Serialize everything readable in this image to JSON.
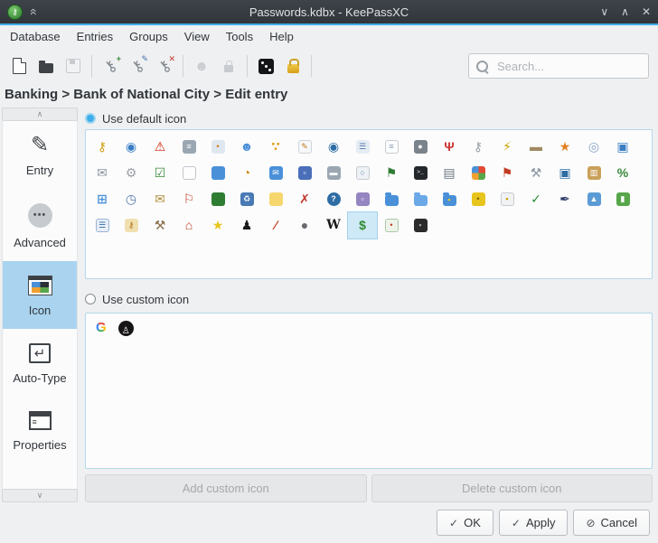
{
  "window": {
    "title": "Passwords.kdbx - KeePassXC"
  },
  "titlebar": {
    "shade_glyph": "«",
    "minimize_glyph": "∨",
    "maximize_glyph": "∧",
    "close_glyph": "✕"
  },
  "menubar": {
    "items": [
      "Database",
      "Entries",
      "Groups",
      "View",
      "Tools",
      "Help"
    ]
  },
  "toolbar": {
    "search_placeholder": "Search...",
    "buttons": [
      {
        "name": "new-database",
        "disabled": false
      },
      {
        "name": "open-database",
        "disabled": false
      },
      {
        "name": "save-database",
        "disabled": true
      },
      {
        "name": "add-entry",
        "disabled": false
      },
      {
        "name": "edit-entry",
        "disabled": false
      },
      {
        "name": "delete-entry",
        "disabled": false
      },
      {
        "name": "copy-username",
        "disabled": true
      },
      {
        "name": "copy-password",
        "disabled": true
      },
      {
        "name": "password-generator",
        "disabled": false
      },
      {
        "name": "lock-database",
        "disabled": false
      }
    ],
    "separators_after": [
      "save-database",
      "delete-entry",
      "copy-password",
      "lock-database"
    ]
  },
  "breadcrumb": {
    "text": "Banking > Bank of National City > Edit entry"
  },
  "sidebar": {
    "scroll_up_glyph": "∧",
    "scroll_down_glyph": "∨",
    "items": [
      {
        "name": "entry",
        "label": "Entry",
        "selected": false
      },
      {
        "name": "advanced",
        "label": "Advanced",
        "selected": false
      },
      {
        "name": "icon",
        "label": "Icon",
        "selected": true
      },
      {
        "name": "auto-type",
        "label": "Auto-Type",
        "selected": false
      },
      {
        "name": "properties",
        "label": "Properties",
        "selected": false
      }
    ]
  },
  "icon_section": {
    "default_radio_label": "Use default icon",
    "default_radio_selected": true,
    "custom_radio_label": "Use custom icon",
    "custom_radio_selected": false,
    "selected_default_icon": "money",
    "default_icons": [
      {
        "name": "key",
        "glyph": "⚷",
        "color": "#d4a017",
        "shape": "plain"
      },
      {
        "name": "world",
        "glyph": "◉",
        "color": "#3b7dc4",
        "shape": "plain"
      },
      {
        "name": "warning",
        "glyph": "⚠",
        "color": "#cc2200",
        "shape": "plain"
      },
      {
        "name": "network-server",
        "glyph": "≡",
        "color": "#ffffff",
        "bg": "#9aa7b2",
        "shape": "chip"
      },
      {
        "name": "marked-directory",
        "glyph": "•",
        "color": "#d4731a",
        "bg": "#dfe8f0",
        "shape": "chip"
      },
      {
        "name": "user-communication",
        "glyph": "☻",
        "color": "#4a90d9",
        "shape": "plain"
      },
      {
        "name": "parts",
        "glyph": "∵",
        "color": "#e0a020",
        "shape": "plain",
        "bold": true
      },
      {
        "name": "notepad",
        "glyph": "✎",
        "color": "#c77b1a",
        "bg": "#f6f8fa",
        "border": "#d0d4d8",
        "shape": "chip"
      },
      {
        "name": "world-socket",
        "glyph": "◉",
        "color": "#2e6da4",
        "shape": "plain"
      },
      {
        "name": "identity",
        "glyph": "☰",
        "color": "#5577aa",
        "bg": "#e4ecf4",
        "shape": "chip"
      },
      {
        "name": "paper-ready",
        "glyph": "≡",
        "color": "#8899aa",
        "bg": "#fbfcfd",
        "border": "#c8ccd0",
        "shape": "chip"
      },
      {
        "name": "digicam",
        "glyph": "●",
        "color": "#ffffff",
        "bg": "#7a838c",
        "shape": "chip"
      },
      {
        "name": "ir-communication",
        "glyph": "Ψ",
        "color": "#cc3333",
        "shape": "plain",
        "bold": true
      },
      {
        "name": "multi-keys",
        "glyph": "⚷",
        "color": "#98a0a8",
        "shape": "plain"
      },
      {
        "name": "energy",
        "glyph": "⚡",
        "color": "#c8a200",
        "shape": "plain"
      },
      {
        "name": "scanner",
        "glyph": "▬",
        "color": "#a08a64",
        "shape": "plain"
      },
      {
        "name": "world-star",
        "glyph": "★",
        "color": "#e08020",
        "shape": "plain"
      },
      {
        "name": "cdrom",
        "glyph": "◎",
        "color": "#8aa4c8",
        "shape": "plain"
      },
      {
        "name": "monitor",
        "glyph": "▣",
        "color": "#3b7dc4",
        "shape": "plain"
      },
      {
        "name": "email",
        "glyph": "✉",
        "color": "#8a94a0",
        "shape": "plain"
      },
      {
        "name": "configuration",
        "glyph": "⚙",
        "color": "#9aa0a6",
        "shape": "plain"
      },
      {
        "name": "clipboard-ready",
        "glyph": "☑",
        "color": "#3a8a3a",
        "shape": "plain"
      },
      {
        "name": "paper-new",
        "glyph": "",
        "bg": "#fdfdfe",
        "border": "#c2c6ca",
        "shape": "chip"
      },
      {
        "name": "screen",
        "glyph": "",
        "bg": "#4a90d9",
        "shape": "chip"
      },
      {
        "name": "energy-careful",
        "glyph": "◔",
        "color": "#cc8800",
        "shape": "plain"
      },
      {
        "name": "email-box",
        "glyph": "✉",
        "color": "#ffffff",
        "bg": "#4a90d9",
        "shape": "chip"
      },
      {
        "name": "disk",
        "glyph": "▫",
        "color": "#ffffff",
        "bg": "#4a6fb8",
        "shape": "chip"
      },
      {
        "name": "drive",
        "glyph": "▬",
        "color": "#ffffff",
        "bg": "#9aa7b2",
        "shape": "chip"
      },
      {
        "name": "paper-q",
        "glyph": "○",
        "color": "#5a82aa",
        "bg": "#eef2f6",
        "border": "#c8ccd0",
        "shape": "chip",
        "bold": true
      },
      {
        "name": "terminal-encrypted",
        "glyph": "⚑",
        "color": "#2e7d32",
        "shape": "plain"
      },
      {
        "name": "console",
        "glyph": ">_",
        "shape": "terminal"
      },
      {
        "name": "printer",
        "glyph": "▤",
        "color": "#6a7680",
        "shape": "plain"
      },
      {
        "name": "program-icons",
        "glyph": "",
        "shape": "quad"
      },
      {
        "name": "run",
        "glyph": "⚑",
        "color": "#c23b22",
        "shape": "plain"
      },
      {
        "name": "settings",
        "glyph": "⚒",
        "color": "#8a94a0",
        "shape": "plain"
      },
      {
        "name": "world-computer",
        "glyph": "▣",
        "color": "#2e6da4",
        "shape": "plain"
      },
      {
        "name": "archive",
        "glyph": "▥",
        "color": "#ffffff",
        "bg": "#caa05a",
        "shape": "chip"
      },
      {
        "name": "homebanking",
        "glyph": "%",
        "color": "#3a8a3a",
        "shape": "plain",
        "bold": true
      },
      {
        "name": "drive-windows",
        "glyph": "⊞",
        "color": "#4a90d9",
        "shape": "plain",
        "bold": true
      },
      {
        "name": "clock",
        "glyph": "◷",
        "color": "#5577aa",
        "shape": "plain"
      },
      {
        "name": "email-search",
        "glyph": "✉",
        "color": "#b09040",
        "shape": "plain"
      },
      {
        "name": "paper-flag",
        "glyph": "⚐",
        "color": "#c23b22",
        "shape": "plain"
      },
      {
        "name": "memory",
        "glyph": "",
        "bg": "#2e7d32",
        "shape": "chip"
      },
      {
        "name": "trash-bin",
        "glyph": "♻",
        "color": "#ffffff",
        "bg": "#4a7ab5",
        "shape": "chip"
      },
      {
        "name": "note",
        "glyph": "",
        "bg": "#f5d76e",
        "shape": "chip"
      },
      {
        "name": "expired",
        "glyph": "✗",
        "color": "#c0392b",
        "shape": "plain",
        "bold": true
      },
      {
        "name": "info",
        "glyph": "?",
        "color": "#ffffff",
        "bg": "#2e6da4",
        "shape": "circle",
        "bold": true
      },
      {
        "name": "package",
        "glyph": "▫",
        "color": "#ffffff",
        "bg": "#9585c0",
        "shape": "chip"
      },
      {
        "name": "folder",
        "glyph": "",
        "bg": "#4a90d9",
        "shape": "folder"
      },
      {
        "name": "folder-open",
        "glyph": "",
        "bg": "#6aa8e8",
        "shape": "folder"
      },
      {
        "name": "folder-package",
        "glyph": "▪",
        "color": "#e8c51d",
        "bg": "#4a90d9",
        "shape": "folder"
      },
      {
        "name": "lock-open",
        "glyph": "•",
        "color": "#7a5c00",
        "bg": "#e8c51d",
        "shape": "chip"
      },
      {
        "name": "paper-locked",
        "glyph": "▪",
        "color": "#c8a200",
        "bg": "#f0f2f4",
        "border": "#c8ccd0",
        "shape": "chip"
      },
      {
        "name": "checked",
        "glyph": "✓",
        "color": "#2e8b2e",
        "shape": "plain",
        "bold": true
      },
      {
        "name": "pen",
        "glyph": "✒",
        "color": "#2b3a67",
        "shape": "plain"
      },
      {
        "name": "thumbnail",
        "glyph": "▲",
        "color": "#ffffff",
        "bg": "#5b9bd5",
        "shape": "chip"
      },
      {
        "name": "book",
        "glyph": "▮",
        "color": "#ffffff",
        "bg": "#57a64a",
        "shape": "chip"
      },
      {
        "name": "list",
        "glyph": "☰",
        "color": "#2e6da4",
        "bg": "#e8eef8",
        "border": "#9ab4d4",
        "shape": "chip"
      },
      {
        "name": "user-key",
        "glyph": "⚷",
        "color": "#b06a10",
        "bg": "#f0e0b0",
        "shape": "chip"
      },
      {
        "name": "tool",
        "glyph": "⚒",
        "color": "#8a6d4a",
        "shape": "plain"
      },
      {
        "name": "home",
        "glyph": "⌂",
        "color": "#c23b22",
        "shape": "plain",
        "bold": true
      },
      {
        "name": "star",
        "glyph": "★",
        "color": "#e8c51d",
        "shape": "plain"
      },
      {
        "name": "tux",
        "glyph": "♟",
        "color": "#1a1a1a",
        "shape": "plain"
      },
      {
        "name": "feather",
        "glyph": "∕",
        "color": "#c23b22",
        "shape": "plain",
        "bold": true
      },
      {
        "name": "apple",
        "glyph": "●",
        "color": "#666a6e",
        "shape": "plain"
      },
      {
        "name": "wiki",
        "glyph": "W",
        "color": "#1a1a1a",
        "shape": "plain",
        "bold": true,
        "serif": true
      },
      {
        "name": "money",
        "glyph": "$",
        "color": "#2e8b2e",
        "shape": "plain",
        "bold": true
      },
      {
        "name": "certificate",
        "glyph": "•",
        "color": "#c23b22",
        "bg": "#eef4ea",
        "border": "#a8c8a8",
        "shape": "chip"
      },
      {
        "name": "blackberry",
        "glyph": "▪",
        "color": "#9aa0a6",
        "bg": "#2b2b2b",
        "shape": "chip"
      }
    ],
    "custom_icons": [
      {
        "name": "google",
        "glyph": "G"
      },
      {
        "name": "github",
        "glyph": "♙"
      }
    ],
    "add_button_label": "Add custom icon",
    "add_button_enabled": false,
    "delete_button_label": "Delete custom icon",
    "delete_button_enabled": false
  },
  "footer": {
    "ok_label": "OK",
    "ok_glyph": "✓",
    "apply_label": "Apply",
    "apply_glyph": "✓",
    "cancel_label": "Cancel",
    "cancel_glyph": "⊘"
  },
  "colors": {
    "accent": "#3daee9",
    "titlebar_bg": "#31363b",
    "selection_bg": "#a9d3ee",
    "window_bg": "#eff0f1",
    "panel_border": "#b5d8ec",
    "selected_icon_bg": "#cfe9f7"
  }
}
